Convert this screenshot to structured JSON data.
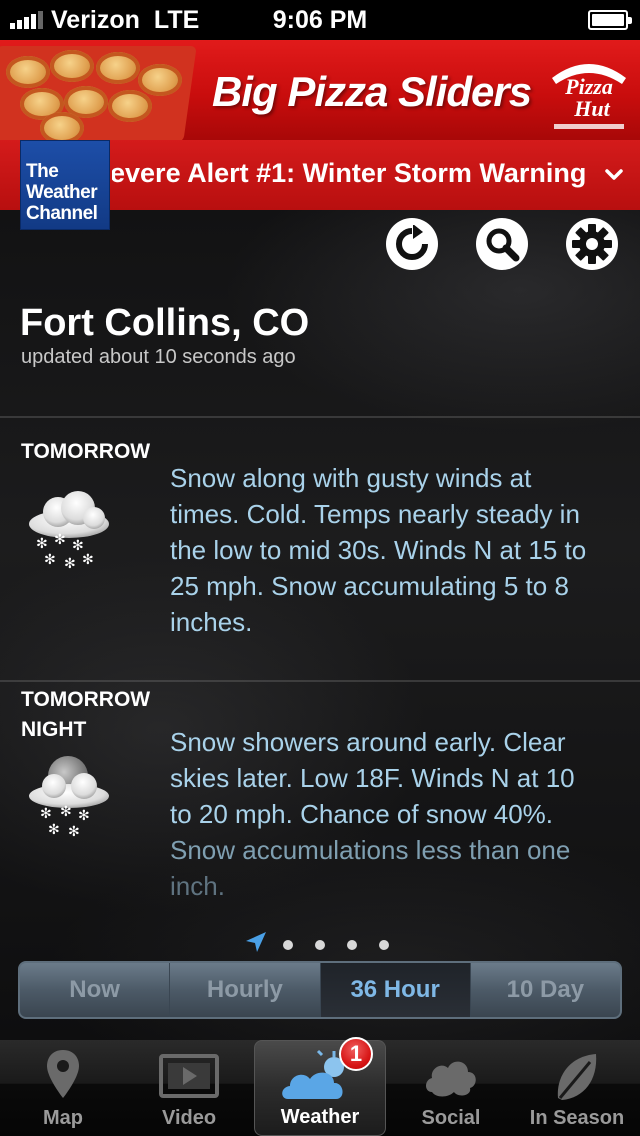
{
  "status_bar": {
    "carrier": "Verizon",
    "network": "LTE",
    "time": "9:06 PM"
  },
  "ad": {
    "headline": "Big Pizza Sliders",
    "brand": "Pizza Hut"
  },
  "alert": {
    "text": "Severe Alert #1: Winter Storm Warning"
  },
  "logo": {
    "line1": "The",
    "line2": "Weather",
    "line3": "Channel"
  },
  "toolbar": {
    "refresh_icon": "refresh-icon",
    "search_icon": "search-icon",
    "settings_icon": "gear-icon"
  },
  "location": {
    "city": "Fort Collins, CO",
    "updated": "updated about 10 seconds ago"
  },
  "forecast": [
    {
      "label_line1": "TOMORROW",
      "label_line2": "",
      "icon": "snow-cloud-icon",
      "lines": [
        "Snow along with gusty winds at",
        "times. Cold. Temps nearly steady in",
        "the low to mid 30s. Winds N at 15 to",
        "25 mph. Snow accumulating 5 to 8",
        "inches."
      ]
    },
    {
      "label_line1": "TOMORROW",
      "label_line2": "NIGHT",
      "icon": "night-snow-icon",
      "lines": [
        "Snow showers around early. Clear",
        "skies later. Low 18F. Winds N at 10",
        "to 20 mph. Chance of snow 40%.",
        "Snow accumulations less than one",
        "inch."
      ]
    }
  ],
  "page_indicator": {
    "pages": 5,
    "current": 0
  },
  "segments": {
    "now": "Now",
    "hourly": "Hourly",
    "hour36": "36 Hour",
    "day10": "10 Day",
    "active": "36 Hour"
  },
  "tabs": {
    "map": "Map",
    "video": "Video",
    "weather": "Weather",
    "weather_badge": "1",
    "social": "Social",
    "in_season": "In Season",
    "active": "Weather"
  },
  "colors": {
    "alert_red": "#c90d0d",
    "forecast_text": "#a9d2ea",
    "active_segment_text": "#7fb8e6",
    "logo_blue": "#1d4ea8"
  }
}
